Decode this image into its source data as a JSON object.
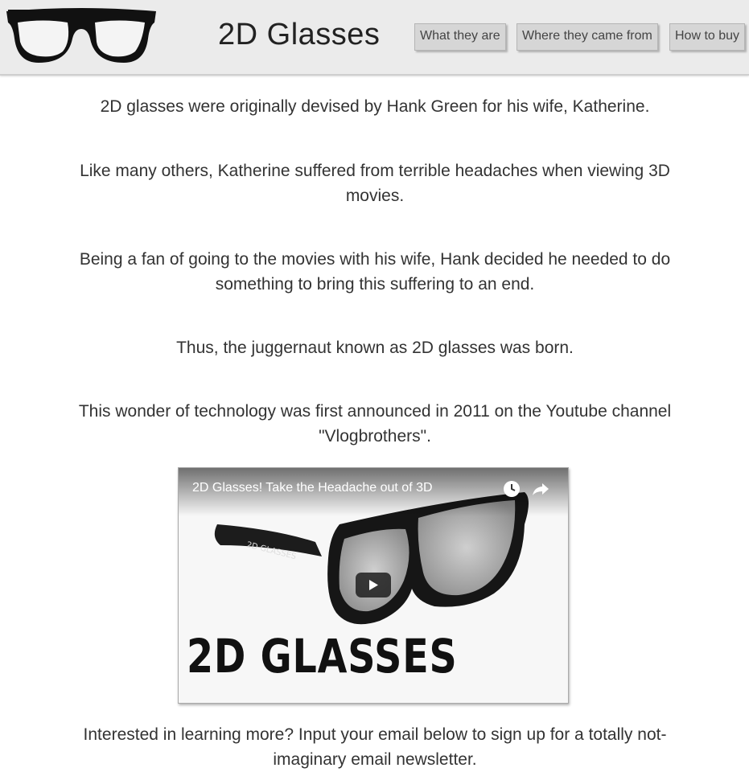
{
  "header": {
    "title": "2D Glasses",
    "menu_icon": "hamburger-icon",
    "logo_icon": "glasses-logo",
    "nav": [
      {
        "label": "What they are"
      },
      {
        "label": "Where they came from"
      },
      {
        "label": "How to buy"
      }
    ]
  },
  "main": {
    "paragraphs": [
      "2D glasses were originally devised by Hank Green for his wife, Katherine.",
      "Like many others, Katherine suffered from terrible headaches when viewing 3D movies.",
      "Being a fan of going to the movies with his wife, Hank decided he needed to do something to bring this suffering to an end.",
      "Thus, the juggernaut known as 2D glasses was born.",
      "This wonder of technology was first announced in 2011 on the Youtube channel \"Vlogbrothers\"."
    ],
    "video": {
      "title": "2D Glasses! Take the Headache out of 3D",
      "brand_text": "2D GLASSES",
      "watch_later_icon": "clock-icon",
      "share_icon": "share-icon",
      "play_icon": "play-icon"
    },
    "signup_text": "Interested in learning more? Input your email below to sign up for a totally not-imaginary email newsletter."
  }
}
